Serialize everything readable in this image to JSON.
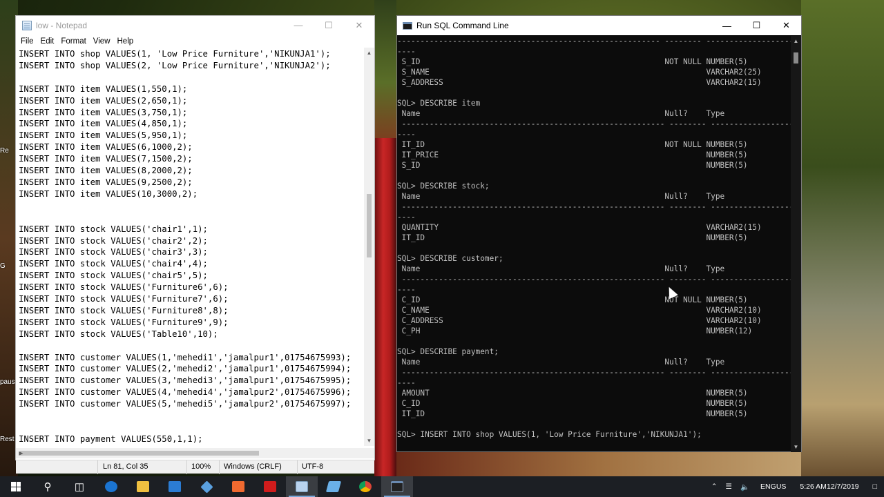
{
  "desktop": {
    "labels": [
      "Re",
      "G",
      "paus",
      "Rest"
    ]
  },
  "notepad": {
    "title": "low - Notepad",
    "menu": [
      "File",
      "Edit",
      "Format",
      "View",
      "Help"
    ],
    "lines": [
      "INSERT INTO shop VALUES(1, 'Low Price Furniture','NIKUNJA1');",
      "INSERT INTO shop VALUES(2, 'Low Price Furniture','NIKUNJA2');",
      "",
      "INSERT INTO item VALUES(1,550,1);",
      "INSERT INTO item VALUES(2,650,1);",
      "INSERT INTO item VALUES(3,750,1);",
      "INSERT INTO item VALUES(4,850,1);",
      "INSERT INTO item VALUES(5,950,1);",
      "INSERT INTO item VALUES(6,1000,2);",
      "INSERT INTO item VALUES(7,1500,2);",
      "INSERT INTO item VALUES(8,2000,2);",
      "INSERT INTO item VALUES(9,2500,2);",
      "INSERT INTO item VALUES(10,3000,2);",
      "",
      "",
      "INSERT INTO stock VALUES('chair1',1);",
      "INSERT INTO stock VALUES('chair2',2);",
      "INSERT INTO stock VALUES('chair3',3);",
      "INSERT INTO stock VALUES('chair4',4);",
      "INSERT INTO stock VALUES('chair5',5);",
      "INSERT INTO stock VALUES('Furniture6',6);",
      "INSERT INTO stock VALUES('Furniture7',6);",
      "INSERT INTO stock VALUES('Furniture8',8);",
      "INSERT INTO stock VALUES('Furniture9',9);",
      "INSERT INTO stock VALUES('Table10',10);",
      "",
      "INSERT INTO customer VALUES(1,'mehedi1','jamalpur1',01754675993);",
      "INSERT INTO customer VALUES(2,'mehedi2','jamalpur1',01754675994);",
      "INSERT INTO customer VALUES(3,'mehedi3','jamalpur1',01754675995);",
      "INSERT INTO customer VALUES(4,'mehedi4','jamalpur2',01754675996);",
      "INSERT INTO customer VALUES(5,'mehedi5','jamalpur2',01754675997);",
      "",
      "",
      "INSERT INTO payment VALUES(550,1,1);"
    ],
    "status": {
      "position": "Ln 81, Col 35",
      "zoom": "100%",
      "line_ending": "Windows (CRLF)",
      "encoding": "UTF-8"
    }
  },
  "console": {
    "title": "Run SQL Command Line",
    "lines": [
      "--------------------------------------------------------- -------- --------------------",
      "----",
      " S_ID                                                     NOT NULL NUMBER(5)",
      " S_NAME                                                            VARCHAR2(25)",
      " S_ADDRESS                                                         VARCHAR2(15)",
      "",
      "SQL> DESCRIBE item",
      " Name                                                     Null?    Type",
      " --------------------------------------------------------- -------- --------------------",
      "----",
      " IT_ID                                                    NOT NULL NUMBER(5)",
      " IT_PRICE                                                          NUMBER(5)",
      " S_ID                                                              NUMBER(5)",
      "",
      "SQL> DESCRIBE stock;",
      " Name                                                     Null?    Type",
      " --------------------------------------------------------- -------- --------------------",
      "----",
      " QUANTITY                                                          VARCHAR2(15)",
      " IT_ID                                                             NUMBER(5)",
      "",
      "SQL> DESCRIBE customer;",
      " Name                                                     Null?    Type",
      " --------------------------------------------------------- -------- --------------------",
      "----",
      " C_ID                                                     NOT NULL NUMBER(5)",
      " C_NAME                                                            VARCHAR2(10)",
      " C_ADDRESS                                                         VARCHAR2(10)",
      " C_PH                                                              NUMBER(12)",
      "",
      "SQL> DESCRIBE payment;",
      " Name                                                     Null?    Type",
      " --------------------------------------------------------- -------- --------------------",
      "----",
      " AMOUNT                                                            NUMBER(5)",
      " C_ID                                                              NUMBER(5)",
      " IT_ID                                                             NUMBER(5)",
      "",
      "SQL> INSERT INTO shop VALUES(1, 'Low Price Furniture','NIKUNJA1');"
    ]
  },
  "taskbar": {
    "icons": [
      "windows-start-icon",
      "search-icon",
      "task-view-icon",
      "edge-icon",
      "file-explorer-icon",
      "store-icon",
      "box-app-icon",
      "xampp-icon",
      "acrobat-icon",
      "notepad-icon",
      "app-icon",
      "chrome-icon",
      "sql-command-line-icon"
    ],
    "language": "ENG",
    "region": "US",
    "time": "5:26 AM",
    "date": "12/7/2019"
  },
  "colors": {
    "console_bg": "#0c0c0c",
    "console_fg": "#c0c0c0",
    "taskbar_bg": "#1c1f24"
  }
}
